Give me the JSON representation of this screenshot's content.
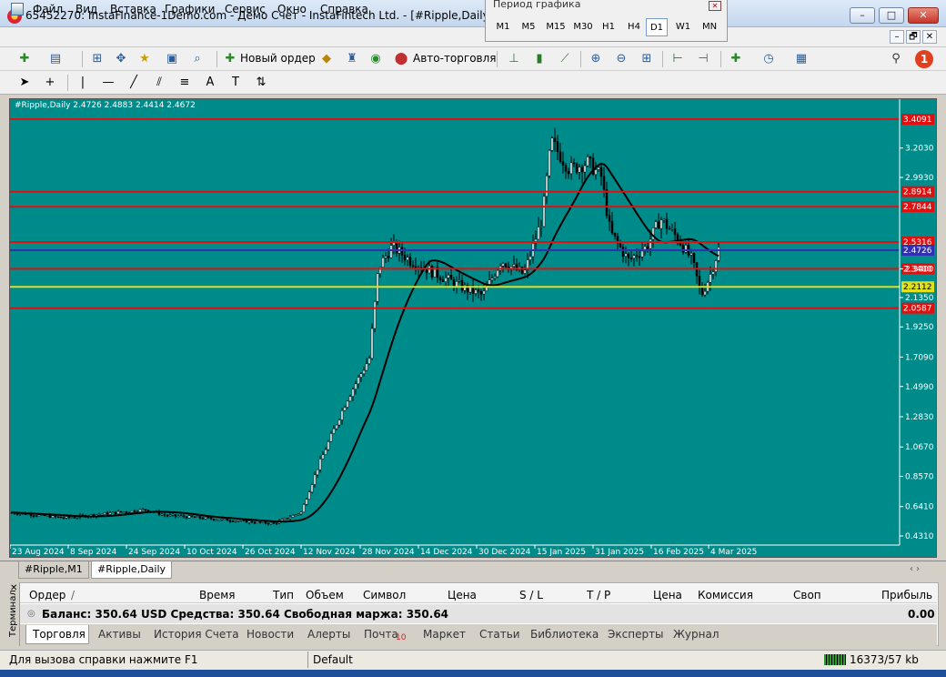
{
  "window": {
    "title": "65452270: InstaFinance-1Demo.com - Демо Счет - InstaFintech Ltd. - [#Ripple,Daily]",
    "buttons": [
      "–",
      "□",
      "✕"
    ]
  },
  "period_panel": {
    "caption": "Период графика",
    "periods": [
      "M1",
      "M5",
      "M15",
      "M30",
      "H1",
      "H4",
      "D1",
      "W1",
      "MN"
    ],
    "active": "D1"
  },
  "menu": {
    "items": [
      "Файл",
      "Вид",
      "Вставка",
      "Графики",
      "Сервис",
      "Окно",
      "Справка"
    ],
    "mdi_buttons": [
      "–",
      "🗗",
      "✕"
    ]
  },
  "toolbar": {
    "new_order": "Новый ордер",
    "auto_trading": "Авто-торговля"
  },
  "chart": {
    "header": "#Ripple,Daily  2.4726 2.4883 2.4414 2.4672",
    "bg_color": "#008b8b",
    "price_labels": [
      "3.2030",
      "2.9930",
      "2.3400",
      "2.1350",
      "1.9250",
      "1.7090",
      "1.4990",
      "1.2830",
      "1.0670",
      "0.8570",
      "0.6410",
      "0.4310"
    ],
    "levels": [
      {
        "price": 3.4091,
        "label": "3.4091",
        "color": "#e01010"
      },
      {
        "price": 2.8914,
        "label": "2.8914",
        "color": "#e01010"
      },
      {
        "price": 2.7844,
        "label": "2.7844",
        "color": "#e01010"
      },
      {
        "price": 2.5316,
        "label": "2.5316",
        "color": "#e01010"
      },
      {
        "price": 2.4726,
        "label": "2.4726",
        "color": "#3030b0"
      },
      {
        "price": 2.34,
        "label": "2.3400",
        "color": "#e01010"
      },
      {
        "price": 2.2112,
        "label": "2.2112",
        "color": "#e0e020"
      },
      {
        "price": 2.0587,
        "label": "2.0587",
        "color": "#e01010"
      }
    ],
    "date_labels": [
      "23 Aug 2024",
      "8 Sep 2024",
      "24 Sep 2024",
      "10 Oct 2024",
      "26 Oct 2024",
      "12 Nov 2024",
      "28 Nov 2024",
      "14 Dec 2024",
      "30 Dec 2024",
      "15 Jan 2025",
      "31 Jan 2025",
      "16 Feb 2025",
      "4 Mar 2025"
    ]
  },
  "chart_tabs": [
    "#Ripple,M1",
    "#Ripple,Daily"
  ],
  "chart_tab_active": "#Ripple,Daily",
  "terminal": {
    "side_label": "Терминал",
    "columns": [
      "Ордер",
      "/",
      "Время",
      "Тип",
      "Объем",
      "Символ",
      "Цена",
      "S / L",
      "T / P",
      "Цена",
      "Комиссия",
      "Своп",
      "Прибыль"
    ],
    "balance_line": "Баланс: 350.64 USD  Средства: 350.64  Свободная маржа: 350.64",
    "profit": "0.00",
    "tabs": [
      "Торговля",
      "Активы",
      "История Счета",
      "Новости",
      "Алерты",
      "Почта",
      "Маркет",
      "Статьи",
      "Библиотека",
      "Эксперты",
      "Журнал"
    ],
    "mail_badge": "10",
    "active_tab": "Торговля"
  },
  "status": {
    "help": "Для вызова справки нажмите F1",
    "profile": "Default",
    "traffic": "16373/57 kb"
  }
}
